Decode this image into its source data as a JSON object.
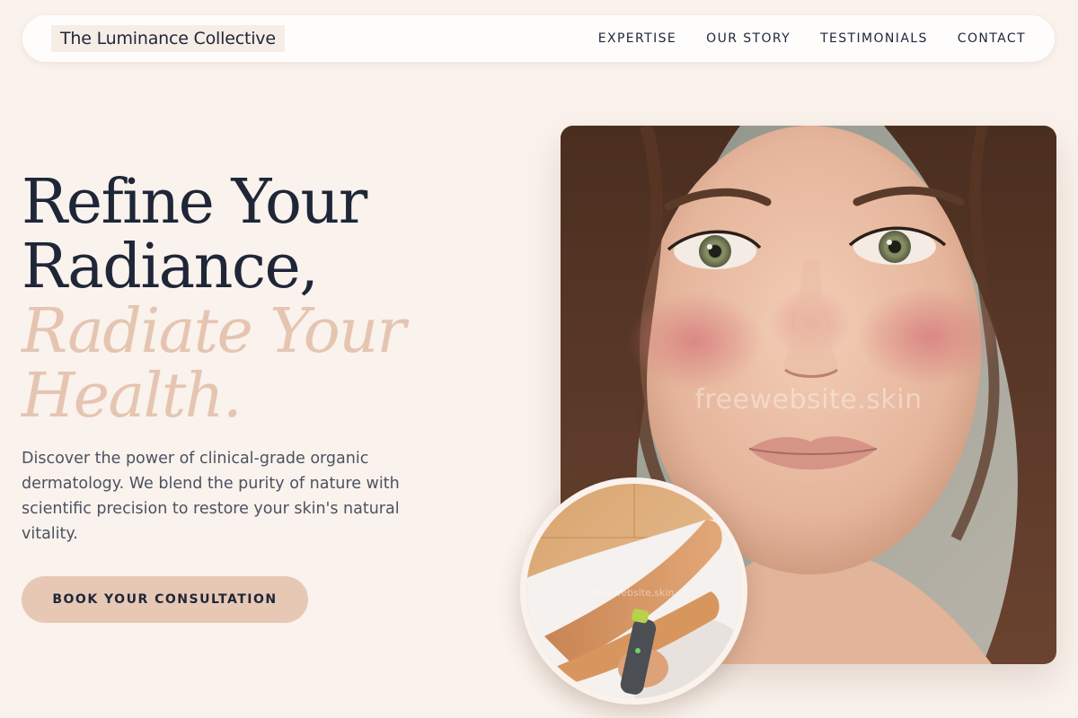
{
  "brand": {
    "name": "The Luminance Collective"
  },
  "nav": {
    "items": [
      "EXPERTISE",
      "OUR STORY",
      "TESTIMONIALS",
      "CONTACT"
    ]
  },
  "hero": {
    "title_line1": "Refine Your",
    "title_line2": "Radiance,",
    "title_accent_line1": "Radiate Your",
    "title_accent_line2": "Health.",
    "description": "Discover the power of clinical-grade organic dermatology. We blend the purity of nature with scientific precision to restore your skin's natural vitality.",
    "cta_label": "BOOK YOUR CONSULTATION"
  },
  "images": {
    "main_watermark": "freewebsite.skin",
    "circle_watermark": "freewebsite.skin"
  },
  "colors": {
    "background": "#faf2ec",
    "navy": "#1e2638",
    "accent": "#e5c5b1",
    "button": "#e7c8b4"
  }
}
